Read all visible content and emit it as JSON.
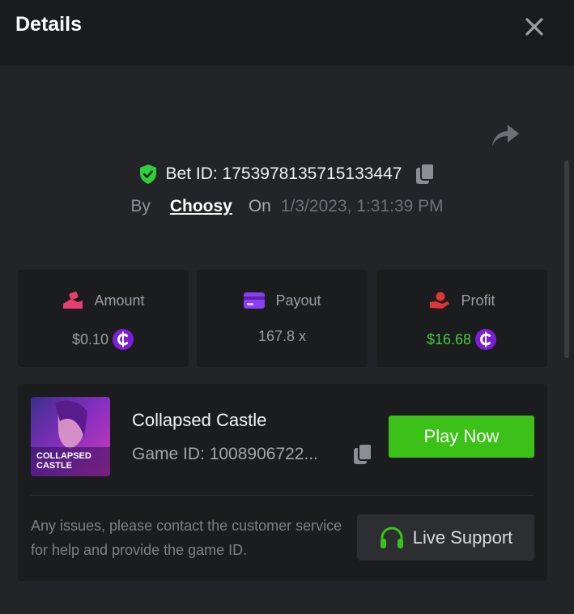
{
  "header": {
    "title": "Details"
  },
  "bet": {
    "id_label": "Bet ID: 1753978135715133447",
    "by_label": "By",
    "user": "Choosy",
    "on_label": "On",
    "date": "1/3/2023, 1:31:39 PM"
  },
  "stats": [
    {
      "label": "Amount",
      "value": "$0.10",
      "icon": "amount-icon"
    },
    {
      "label": "Payout",
      "value": "167.8 x",
      "icon": "card-icon"
    },
    {
      "label": "Profit",
      "value": "$16.68",
      "icon": "hand-coin-icon"
    }
  ],
  "game": {
    "name": "Collapsed Castle",
    "id_label": "Game ID: 1008906722...",
    "thumb_line1": "COLLAPSED",
    "thumb_line2": "CASTLE",
    "play_label": "Play Now"
  },
  "support": {
    "message": "Any issues, please contact the customer service for help and provide the game ID.",
    "button_label": "Live Support"
  },
  "colors": {
    "accent_green": "#3bc117",
    "profit_green": "#47c93d",
    "coin_purple": "#7a1fd6",
    "shield_green": "#2bd03a"
  }
}
